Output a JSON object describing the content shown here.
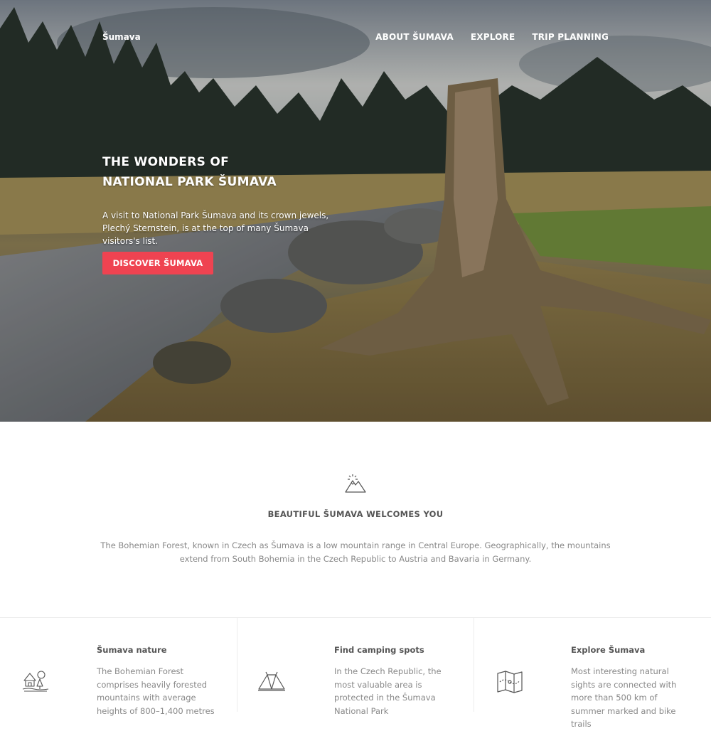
{
  "header": {
    "brand": "Šumava",
    "nav": [
      "ABOUT ŠUMAVA",
      "EXPLORE",
      "TRIP PLANNING"
    ]
  },
  "hero": {
    "title_line1": "THE WONDERS OF",
    "title_line2": "NATIONAL PARK ŠUMAVA",
    "text": "A visit to National Park Šumava and its crown jewels, Plechý Sternstein, is at the top of many Šumava visitors's list.",
    "button_label": "DISCOVER ŠUMAVA"
  },
  "welcome": {
    "icon": "mountain-icon",
    "heading": "BEAUTIFUL ŠUMAVA WELCOMES YOU",
    "text": "The Bohemian Forest, known in Czech as Šumava is a low mountain range in Central Europe. Geographically, the mountains extend from South Bohemia in the Czech Republic to Austria and Bavaria in Germany."
  },
  "features": [
    {
      "icon": "forest-cabin-icon",
      "title": "Šumava nature",
      "text": "The Bohemian Forest comprises heavily forested mountains with average heights of 800–1,400 metres"
    },
    {
      "icon": "tent-icon",
      "title": "Find camping spots",
      "text": "In the Czech Republic, the most valuable area is protected in the Šumava National Park"
    },
    {
      "icon": "map-icon",
      "title": "Explore Šumava",
      "text": "Most interesting natural sights are connected with more than 500 km of summer marked and bike trails"
    }
  ],
  "colors": {
    "accent": "#ef4351",
    "heading": "#555555",
    "body_text": "#888888",
    "divider": "#ececec"
  }
}
